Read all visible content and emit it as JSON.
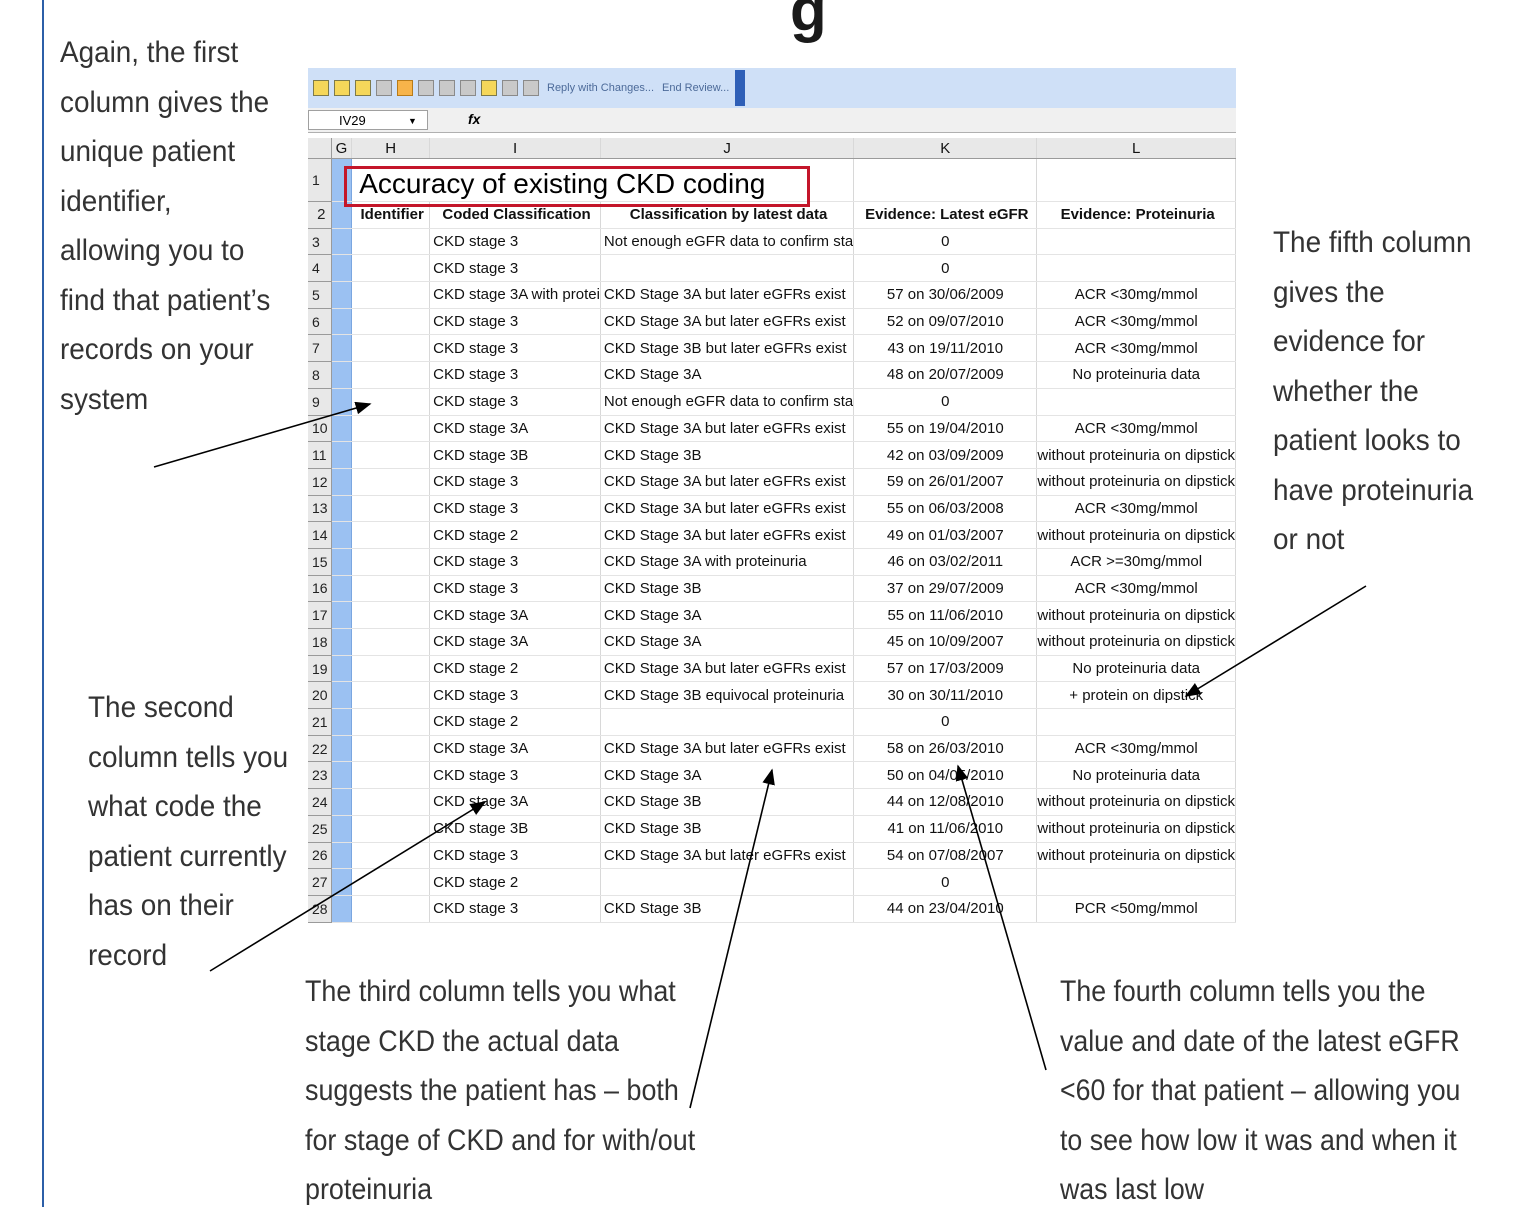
{
  "slide": {
    "title_fragment": "g",
    "note_first_column": [
      "Again, the first",
      "column gives the",
      "unique patient",
      "identifier,",
      "allowing you to",
      "find that patient’s",
      "records on your",
      "system"
    ],
    "note_fifth_column": [
      "The fifth column",
      "gives the",
      "evidence for",
      "whether the",
      "patient looks to",
      "have proteinuria",
      "or not"
    ],
    "note_second_column": [
      "The second",
      "column tells you",
      "what code the",
      "patient currently",
      "has on their",
      "record"
    ],
    "note_third_column": [
      "The third column tells you what",
      "stage CKD the actual data",
      "suggests the patient has – both",
      "for stage of CKD and for with/out",
      "proteinuria"
    ],
    "note_fourth_column": [
      "The fourth column tells you the",
      "value and date of the latest eGFR",
      "<60 for that patient – allowing you",
      "to see how low it was and when it",
      "was last low"
    ]
  },
  "spreadsheet": {
    "toolbar": {
      "reply_label": "Reply with Changes...",
      "end_review_label": "End Review..."
    },
    "name_box": "IV29",
    "fx_label": "fx",
    "column_headers": [
      "G",
      "H",
      "I",
      "J",
      "K",
      "L"
    ],
    "title": "Accuracy of existing CKD coding",
    "field_headers": [
      "Identifier",
      "Coded Classification",
      "Classification by latest data",
      "Evidence: Latest eGFR",
      "Evidence: Proteinuria"
    ],
    "rows": [
      {
        "n": "3",
        "coded": "CKD stage 3",
        "latest": "Not enough eGFR data to confirm sta",
        "egfr": "0",
        "prot": ""
      },
      {
        "n": "4",
        "coded": "CKD stage 3",
        "latest": "",
        "egfr": "0",
        "prot": ""
      },
      {
        "n": "5",
        "coded": "CKD stage 3A with protei",
        "latest": "CKD Stage 3A but later eGFRs exist",
        "egfr": "57 on 30/06/2009",
        "prot": "ACR <30mg/mmol"
      },
      {
        "n": "6",
        "coded": "CKD stage 3",
        "latest": "CKD Stage 3A but later eGFRs exist",
        "egfr": "52 on 09/07/2010",
        "prot": "ACR <30mg/mmol"
      },
      {
        "n": "7",
        "coded": "CKD stage 3",
        "latest": "CKD Stage 3B but later eGFRs exist",
        "egfr": "43 on 19/11/2010",
        "prot": "ACR <30mg/mmol"
      },
      {
        "n": "8",
        "coded": "CKD stage 3",
        "latest": "CKD Stage 3A",
        "egfr": "48 on 20/07/2009",
        "prot": "No proteinuria data"
      },
      {
        "n": "9",
        "coded": "CKD stage 3",
        "latest": "Not enough eGFR data to confirm sta",
        "egfr": "0",
        "prot": ""
      },
      {
        "n": "10",
        "coded": "CKD stage 3A",
        "latest": "CKD Stage 3A but later eGFRs exist",
        "egfr": "55 on 19/04/2010",
        "prot": "ACR <30mg/mmol"
      },
      {
        "n": "11",
        "coded": "CKD stage 3B",
        "latest": "CKD Stage 3B",
        "egfr": "42 on 03/09/2009",
        "prot": "without proteinuria on dipstick"
      },
      {
        "n": "12",
        "coded": "CKD stage 3",
        "latest": "CKD Stage 3A but later eGFRs exist",
        "egfr": "59 on 26/01/2007",
        "prot": "without proteinuria on dipstick"
      },
      {
        "n": "13",
        "coded": "CKD stage 3",
        "latest": "CKD Stage 3A but later eGFRs exist",
        "egfr": "55 on 06/03/2008",
        "prot": "ACR <30mg/mmol"
      },
      {
        "n": "14",
        "coded": "CKD stage 2",
        "latest": "CKD Stage 3A but later eGFRs exist",
        "egfr": "49 on 01/03/2007",
        "prot": "without proteinuria on dipstick"
      },
      {
        "n": "15",
        "coded": "CKD stage 3",
        "latest": "CKD Stage 3A with proteinuria",
        "egfr": "46 on 03/02/2011",
        "prot": "ACR >=30mg/mmol"
      },
      {
        "n": "16",
        "coded": "CKD stage 3",
        "latest": "CKD Stage 3B",
        "egfr": "37 on 29/07/2009",
        "prot": "ACR <30mg/mmol"
      },
      {
        "n": "17",
        "coded": "CKD stage 3A",
        "latest": "CKD Stage 3A",
        "egfr": "55 on 11/06/2010",
        "prot": "without proteinuria on dipstick"
      },
      {
        "n": "18",
        "coded": "CKD stage 3A",
        "latest": "CKD Stage 3A",
        "egfr": "45 on 10/09/2007",
        "prot": "without proteinuria on dipstick"
      },
      {
        "n": "19",
        "coded": "CKD stage 2",
        "latest": "CKD Stage 3A but later eGFRs exist",
        "egfr": "57 on 17/03/2009",
        "prot": "No proteinuria data"
      },
      {
        "n": "20",
        "coded": "CKD stage 3",
        "latest": "CKD Stage 3B equivocal proteinuria",
        "egfr": "30 on 30/11/2010",
        "prot": "+ protein on dipstick"
      },
      {
        "n": "21",
        "coded": "CKD stage 2",
        "latest": "",
        "egfr": "0",
        "prot": ""
      },
      {
        "n": "22",
        "coded": "CKD stage 3A",
        "latest": "CKD Stage 3A but later eGFRs exist",
        "egfr": "58 on 26/03/2010",
        "prot": "ACR <30mg/mmol"
      },
      {
        "n": "23",
        "coded": "CKD stage 3",
        "latest": "CKD Stage 3A",
        "egfr": "50 on 04/05/2010",
        "prot": "No proteinuria data"
      },
      {
        "n": "24",
        "coded": "CKD stage 3A",
        "latest": "CKD Stage 3B",
        "egfr": "44 on 12/08/2010",
        "prot": "without proteinuria on dipstick"
      },
      {
        "n": "25",
        "coded": "CKD stage 3B",
        "latest": "CKD Stage 3B",
        "egfr": "41 on 11/06/2010",
        "prot": "without proteinuria on dipstick"
      },
      {
        "n": "26",
        "coded": "CKD stage 3",
        "latest": "CKD Stage 3A but later eGFRs exist",
        "egfr": "54 on 07/08/2007",
        "prot": "without proteinuria on dipstick"
      },
      {
        "n": "27",
        "coded": "CKD stage 2",
        "latest": "",
        "egfr": "0",
        "prot": ""
      },
      {
        "n": "28",
        "coded": "CKD stage 3",
        "latest": "CKD Stage 3B",
        "egfr": "44 on 23/04/2010",
        "prot": "PCR <50mg/mmol"
      }
    ]
  },
  "colors": {
    "accent_blue": "#2c5fa8",
    "highlight_red": "#c4162a",
    "selected_column": "#9bc1f2"
  }
}
